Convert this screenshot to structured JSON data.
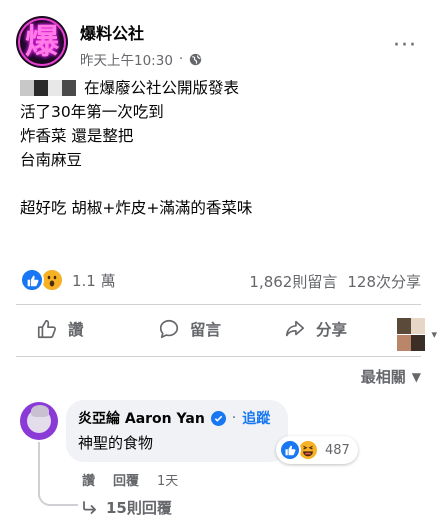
{
  "post": {
    "page_name": "爆料公社",
    "avatar_glyph": "爆",
    "timestamp": "昨天上午10:30",
    "more_label": "···",
    "lines": [
      "在爆廢公社公開版發表",
      "活了30年第一次吃到",
      "炸香菜 還是整把",
      "台南麻豆",
      "",
      "超好吃 胡椒+炸皮+滿滿的香菜味"
    ]
  },
  "stats": {
    "reaction_count": "1.1 萬",
    "comments": "1,862則留言",
    "shares": "128次分享"
  },
  "actions": {
    "like": "讚",
    "comment": "留言",
    "share": "分享"
  },
  "comments_section": {
    "sort_label": "最相關"
  },
  "comment": {
    "author": "炎亞綸 Aaron Yan",
    "follow": "追蹤",
    "separator": "·",
    "text": "神聖的食物",
    "reaction_count": "487",
    "like_action": "讚",
    "reply_action": "回覆",
    "time": "1天",
    "replies_label": "15則回覆"
  },
  "colors": {
    "accent": "#1877f2",
    "secondary_text": "#65676b",
    "bubble": "#f0f2f5"
  },
  "icons": [
    "globe-icon",
    "like-reaction-icon",
    "wow-reaction-icon",
    "haha-reaction-icon",
    "thumbs-up-icon",
    "comment-icon",
    "share-icon",
    "verified-icon",
    "caret-down-icon",
    "reply-arrow-icon"
  ]
}
